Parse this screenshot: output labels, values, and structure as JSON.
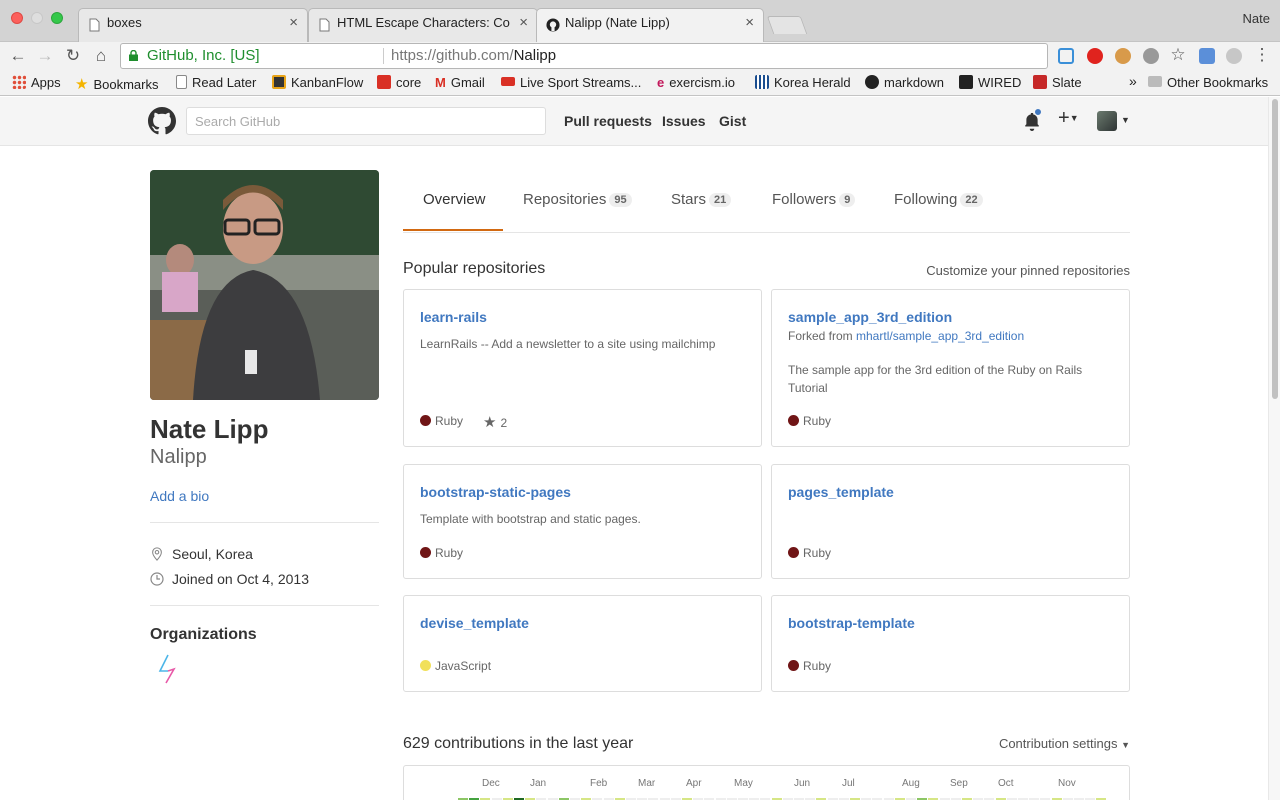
{
  "browser": {
    "tabs": [
      {
        "title": "boxes"
      },
      {
        "title": "HTML Escape Characters: Co"
      },
      {
        "title": "Nalipp (Nate Lipp)"
      }
    ],
    "profile_name": "Nate",
    "omnibox": {
      "ev_label": "GitHub, Inc. [US]",
      "url_prefix": "https://github.com/",
      "url_path": "Nalipp"
    },
    "bookmarks": [
      {
        "label": "Apps",
        "icon": "apps-grid-icon",
        "color": "#e04e39"
      },
      {
        "label": "Bookmarks",
        "icon": "star-icon",
        "color": "#f4b400"
      },
      {
        "label": "Read Later",
        "icon": "page-icon",
        "color": "#ffffff"
      },
      {
        "label": "KanbanFlow",
        "icon": "kanbanflow-icon",
        "color": "#e8a317"
      },
      {
        "label": "core",
        "icon": "core-icon",
        "color": "#d93025"
      },
      {
        "label": "Gmail",
        "icon": "gmail-icon",
        "color": "#d93025"
      },
      {
        "label": "Live Sport Streams...",
        "icon": "live-icon",
        "color": "#d93025"
      },
      {
        "label": "exercism.io",
        "icon": "exercism-icon",
        "color": "#c2185b"
      },
      {
        "label": "Korea Herald",
        "icon": "herald-icon",
        "color": "#1a4d8f"
      },
      {
        "label": "markdown",
        "icon": "github-icon",
        "color": "#222222"
      },
      {
        "label": "WIRED",
        "icon": "wired-icon",
        "color": "#222222"
      },
      {
        "label": "Slate",
        "icon": "slate-icon",
        "color": "#c62828"
      }
    ],
    "other_bookmarks": "Other Bookmarks",
    "chevron": "»"
  },
  "github": {
    "search_placeholder": "Search GitHub",
    "nav": [
      "Pull requests",
      "Issues",
      "Gist"
    ]
  },
  "profile": {
    "fullname": "Nate Lipp",
    "username": "Nalipp",
    "add_bio": "Add a bio",
    "location": "Seoul, Korea",
    "joined": "Joined on Oct 4, 2013",
    "organizations_title": "Organizations"
  },
  "tabs": [
    {
      "label": "Overview",
      "count": ""
    },
    {
      "label": "Repositories",
      "count": "95"
    },
    {
      "label": "Stars",
      "count": "21"
    },
    {
      "label": "Followers",
      "count": "9"
    },
    {
      "label": "Following",
      "count": "22"
    }
  ],
  "popular": {
    "title": "Popular repositories",
    "customize": "Customize your pinned repositories",
    "repos": [
      {
        "name": "learn-rails",
        "fork": "",
        "fork_src": "",
        "description": "LearnRails -- Add a newsletter to a site using mailchimp",
        "language": "Ruby",
        "lang_color": "#701516",
        "stars": "2"
      },
      {
        "name": "sample_app_3rd_edition",
        "fork": "Forked from ",
        "fork_src": "mhartl/sample_app_3rd_edition",
        "description": "The sample app for the 3rd edition of the Ruby on Rails Tutorial",
        "language": "Ruby",
        "lang_color": "#701516",
        "stars": ""
      },
      {
        "name": "bootstrap-static-pages",
        "fork": "",
        "fork_src": "",
        "description": "Template with bootstrap and static pages.",
        "language": "Ruby",
        "lang_color": "#701516",
        "stars": ""
      },
      {
        "name": "pages_template",
        "fork": "",
        "fork_src": "",
        "description": "",
        "language": "Ruby",
        "lang_color": "#701516",
        "stars": ""
      },
      {
        "name": "devise_template",
        "fork": "",
        "fork_src": "",
        "description": "",
        "language": "JavaScript",
        "lang_color": "#f1e05a",
        "stars": ""
      },
      {
        "name": "bootstrap-template",
        "fork": "",
        "fork_src": "",
        "description": "",
        "language": "Ruby",
        "lang_color": "#701516",
        "stars": ""
      }
    ]
  },
  "contributions": {
    "title": "629 contributions in the last year",
    "settings": "Contribution settings",
    "months": [
      "Dec",
      "Jan",
      "Feb",
      "Mar",
      "Apr",
      "May",
      "Jun",
      "Jul",
      "Aug",
      "Sep",
      "Oct",
      "Nov"
    ]
  },
  "colors": {
    "link": "#4078c0",
    "tab_accent": "#d26911",
    "ruby": "#701516",
    "javascript": "#f1e05a"
  }
}
